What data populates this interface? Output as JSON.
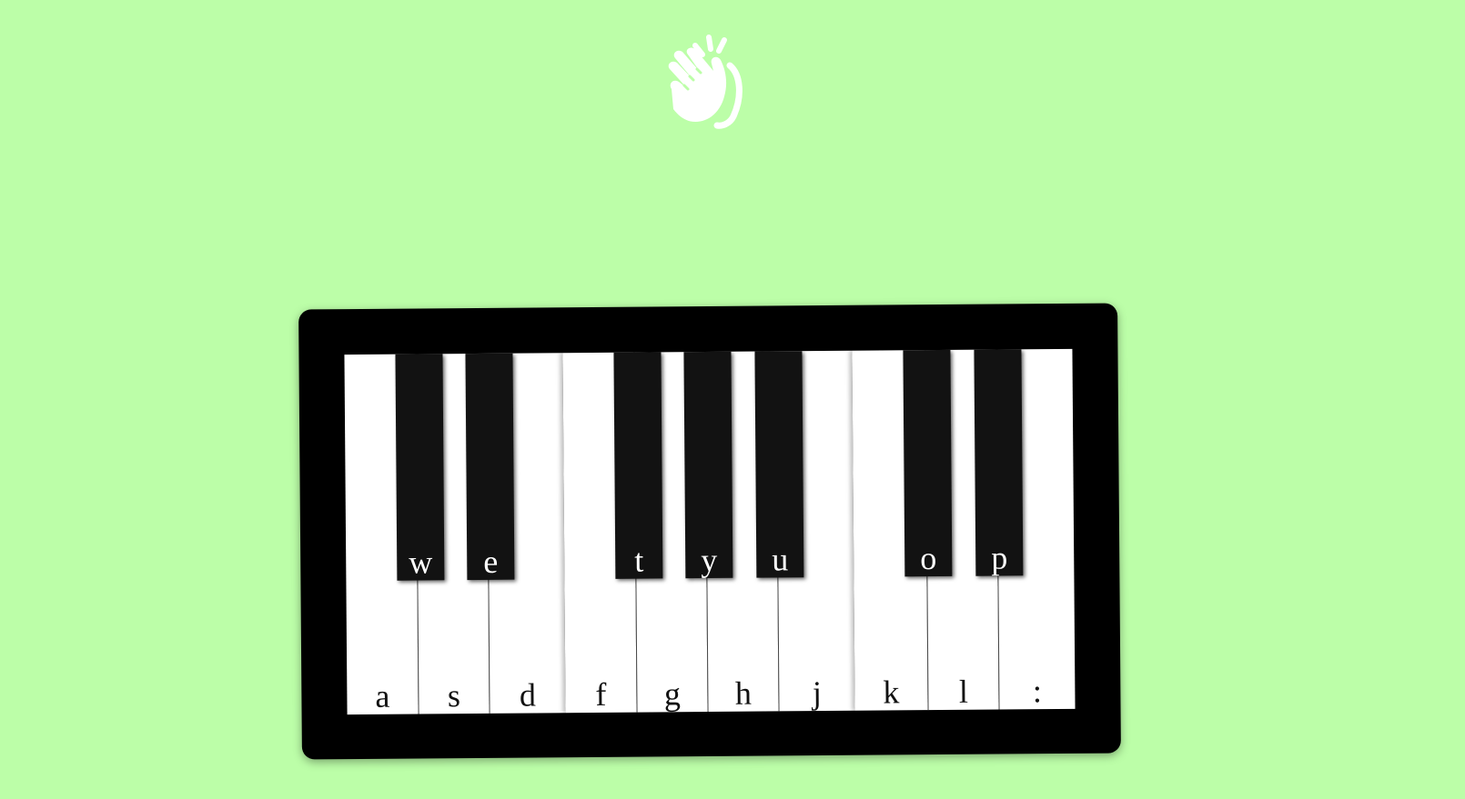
{
  "logo": {
    "icon": "waving-hand-icon",
    "color": "#ffffff"
  },
  "colors": {
    "background": "#bcfea8",
    "frame": "#000000",
    "white_key": "#ffffff",
    "black_key": "#121212"
  },
  "piano": {
    "white_keys": [
      {
        "label": "a"
      },
      {
        "label": "s"
      },
      {
        "label": "d"
      },
      {
        "label": "f"
      },
      {
        "label": "g"
      },
      {
        "label": "h"
      },
      {
        "label": "j"
      },
      {
        "label": "k"
      },
      {
        "label": "l"
      },
      {
        "label": ":"
      }
    ],
    "black_keys": [
      {
        "label": "w"
      },
      {
        "label": "e"
      },
      {
        "label": "t"
      },
      {
        "label": "y"
      },
      {
        "label": "u"
      },
      {
        "label": "o"
      },
      {
        "label": "p"
      }
    ]
  }
}
